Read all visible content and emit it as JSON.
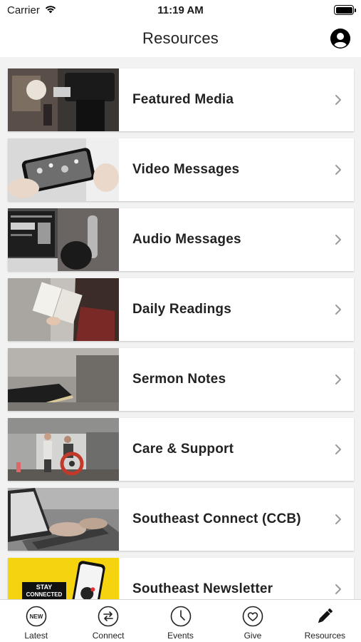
{
  "status_bar": {
    "carrier": "Carrier",
    "time": "11:19 AM"
  },
  "header": {
    "title": "Resources"
  },
  "items": [
    {
      "label": "Featured Media",
      "image": "camera-crew-photo"
    },
    {
      "label": "Video Messages",
      "image": "phone-video-photo"
    },
    {
      "label": "Audio Messages",
      "image": "studio-microphone-photo"
    },
    {
      "label": "Daily Readings",
      "image": "reading-book-photo"
    },
    {
      "label": "Sermon Notes",
      "image": "bible-on-table-photo"
    },
    {
      "label": "Care & Support",
      "image": "care-group-photo"
    },
    {
      "label": "Southeast Connect (CCB)",
      "image": "laptop-typing-photo"
    },
    {
      "label": "Southeast Newsletter",
      "image": "stay-connected-photo",
      "image_text": [
        "STAY",
        "CONNECTED"
      ]
    }
  ],
  "tabs": [
    {
      "label": "Latest",
      "icon": "new-badge-icon",
      "icon_text": "NEW"
    },
    {
      "label": "Connect",
      "icon": "connect-arrows-icon"
    },
    {
      "label": "Events",
      "icon": "clock-icon"
    },
    {
      "label": "Give",
      "icon": "heart-icon"
    },
    {
      "label": "Resources",
      "icon": "pencil-icon",
      "active": true
    }
  ],
  "colors": {
    "newsletter_yellow": "#f5d30f",
    "chevron": "#9a9a9a"
  }
}
